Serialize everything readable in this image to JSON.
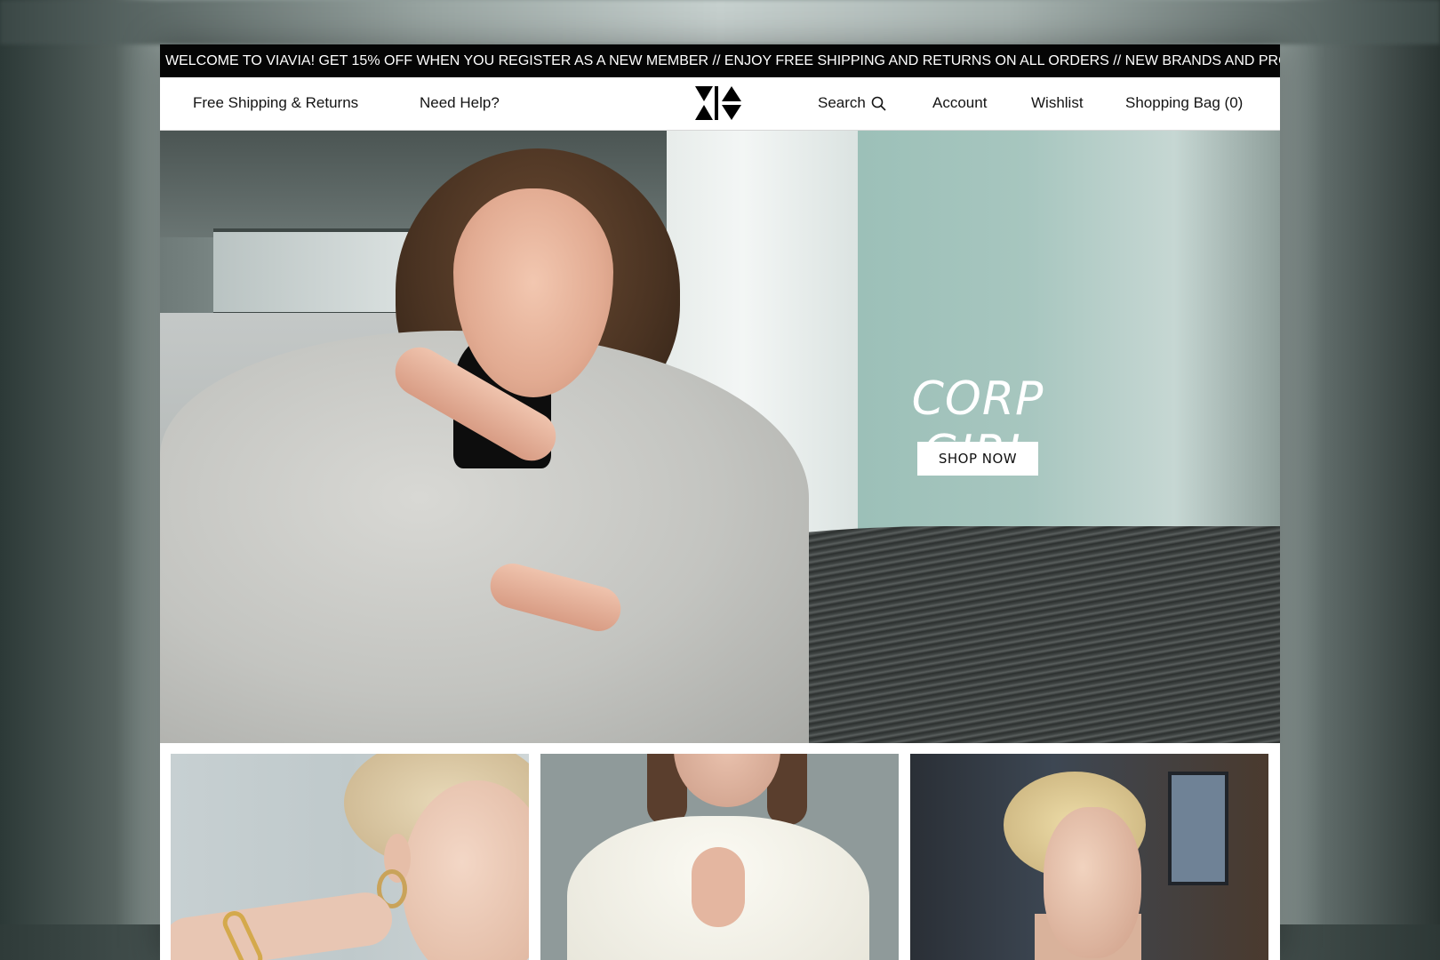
{
  "promo_bar": {
    "text": "WELCOME TO VIAVIA! GET 15% OFF WHEN YOU REGISTER AS A NEW MEMBER //  ENJOY FREE SHIPPING AND RETURNS ON ALL ORDERS // NEW BRANDS AND PROD"
  },
  "header": {
    "free_shipping": "Free Shipping & Returns",
    "need_help": "Need Help?",
    "search": "Search",
    "account": "Account",
    "wishlist": "Wishlist",
    "shopping_bag": "Shopping Bag (0)"
  },
  "hero": {
    "title": "CORP GIRL",
    "button": "SHOP NOW"
  },
  "icons": {
    "logo": "viavia-logo-icon",
    "search": "search-icon"
  },
  "colors": {
    "promo_bg": "#050505",
    "header_bg": "#ffffff",
    "text": "#141414",
    "hero_text": "#ffffff"
  }
}
